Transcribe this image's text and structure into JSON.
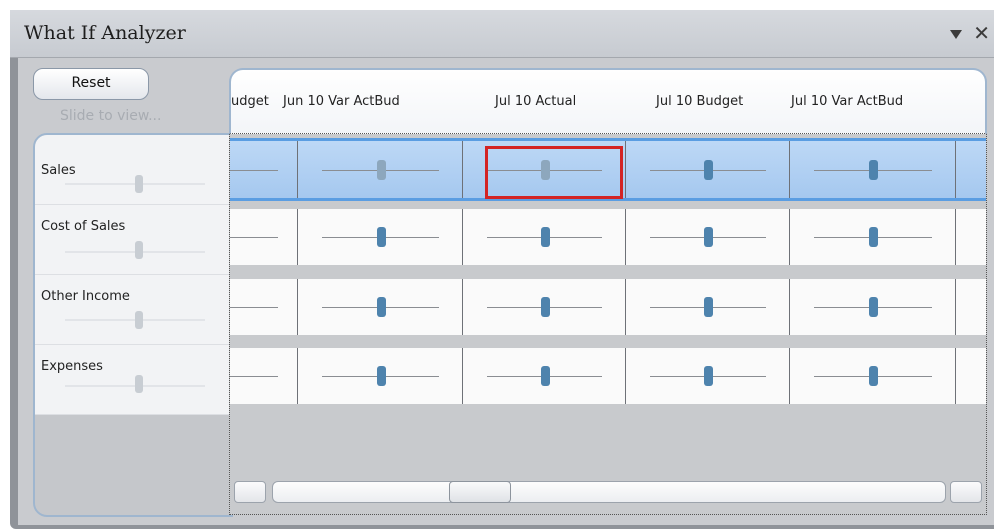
{
  "window": {
    "title": "What If Analyzer",
    "dropdown_icon": "chevron-down-icon",
    "close_icon": "close-icon",
    "close_glyph": "✕"
  },
  "toolbar": {
    "reset_label": "Reset",
    "slide_hint": "Slide to view..."
  },
  "rows": [
    {
      "label": "Sales",
      "selected": true
    },
    {
      "label": "Cost of Sales",
      "selected": false
    },
    {
      "label": "Other Income",
      "selected": false
    },
    {
      "label": "Expenses",
      "selected": false
    }
  ],
  "columns": [
    {
      "label": "udget"
    },
    {
      "label": "Jun 10 Var ActBud"
    },
    {
      "label": "Jul 10 Actual"
    },
    {
      "label": "Jul 10 Budget"
    },
    {
      "label": "Jul 10 Var ActBud"
    }
  ],
  "colors": {
    "selection_blue": "#a5c8ef",
    "thumb_blue": "#4e83ad",
    "focus_red": "#d32424"
  }
}
